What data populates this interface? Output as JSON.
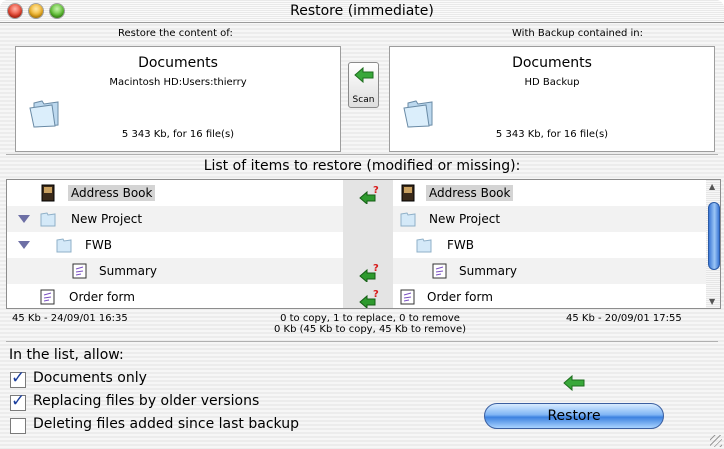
{
  "window": {
    "title": "Restore (immediate)"
  },
  "source": {
    "header": "Restore the content of:",
    "name": "Documents",
    "path": "Macintosh HD:Users:thierry",
    "size": "5 343 Kb, for 16 file(s)"
  },
  "backup": {
    "header": "With Backup contained in:",
    "name": "Documents",
    "path": "HD Backup",
    "size": "5 343 Kb, for 16 file(s)"
  },
  "scan": {
    "label": "Scan"
  },
  "list": {
    "title": "List of items to restore (modified or missing):",
    "rows": [
      {
        "left": "Address Book",
        "right": "Address Book",
        "icon": "address-book-icon"
      },
      {
        "left": "New Project",
        "right": "New Project",
        "icon": "folder-icon"
      },
      {
        "left": "FWB",
        "right": "FWB",
        "icon": "folder-icon"
      },
      {
        "left": "Summary",
        "right": "Summary",
        "icon": "document-icon"
      },
      {
        "left": "Order form",
        "right": "Order form",
        "icon": "document-icon"
      }
    ]
  },
  "footer": {
    "left": "45 Kb - 24/09/01 16:35",
    "center1": "0 to copy, 1 to replace, 0 to remove",
    "center2": "0 Kb (45 Kb to copy, 45 Kb to remove)",
    "right": "45 Kb - 20/09/01 17:55"
  },
  "options": {
    "heading": "In the list, allow:",
    "items": [
      {
        "label": "Documents only",
        "checked": true
      },
      {
        "label": "Replacing files by older versions",
        "checked": true
      },
      {
        "label": "Deleting files added since last backup",
        "checked": false
      }
    ]
  },
  "restore": {
    "label": "Restore"
  },
  "colors": {
    "accent": "#3d82e0",
    "arrow": "#2e9a2e",
    "question": "#d81c1c"
  }
}
